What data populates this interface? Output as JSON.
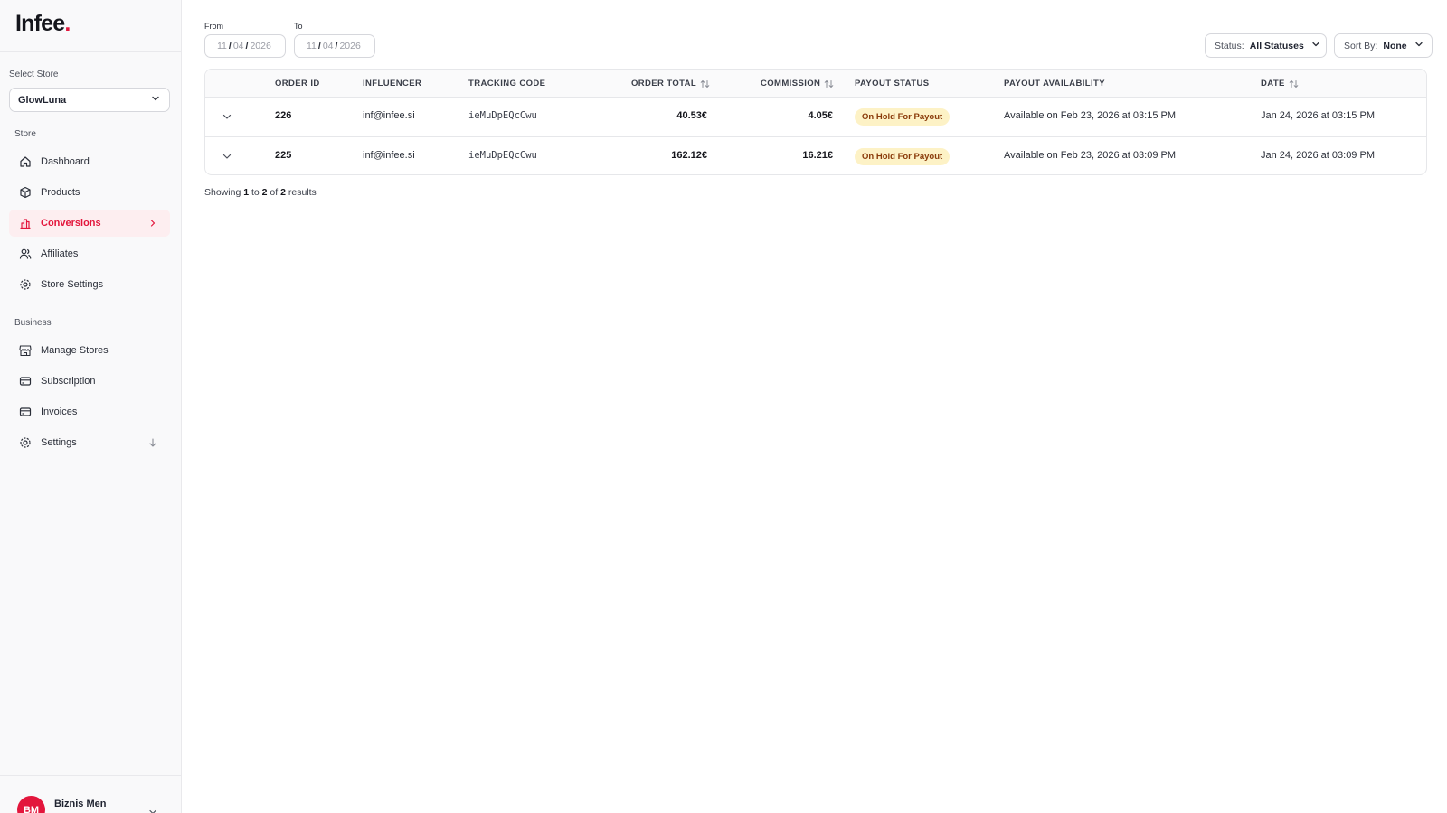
{
  "brand": {
    "name": "Infee",
    "dot": "."
  },
  "sidebar": {
    "select_store_label": "Select Store",
    "selected_store": "GlowLuna",
    "store_section": "Store",
    "store_items": [
      {
        "label": "Dashboard",
        "icon": "home-icon"
      },
      {
        "label": "Products",
        "icon": "box-icon"
      },
      {
        "label": "Conversions",
        "icon": "bar-chart-icon",
        "active": true
      },
      {
        "label": "Affiliates",
        "icon": "users-icon"
      },
      {
        "label": "Store Settings",
        "icon": "gear-icon"
      }
    ],
    "business_section": "Business",
    "business_items": [
      {
        "label": "Manage Stores",
        "icon": "storefront-icon"
      },
      {
        "label": "Subscription",
        "icon": "card-icon"
      },
      {
        "label": "Invoices",
        "icon": "card-icon"
      },
      {
        "label": "Settings",
        "icon": "gear-icon"
      }
    ],
    "user": {
      "initials": "BM",
      "name": "Biznis Men"
    }
  },
  "filters": {
    "from_label": "From",
    "to_label": "To",
    "from": {
      "day": "11",
      "month": "04",
      "year": "2026"
    },
    "to": {
      "day": "11",
      "month": "04",
      "year": "2026"
    },
    "status_label": "Status:",
    "status_value": "All Statuses",
    "sort_label": "Sort By:",
    "sort_value": "None"
  },
  "table": {
    "columns": {
      "order_id": "ORDER ID",
      "influencer": "INFLUENCER",
      "tracking_code": "TRACKING CODE",
      "order_total": "ORDER TOTAL",
      "commission": "COMMISSION",
      "payout_status": "PAYOUT STATUS",
      "payout_availability": "PAYOUT AVAILABILITY",
      "date": "DATE"
    },
    "rows": [
      {
        "order_id": "226",
        "influencer": "inf@infee.si",
        "tracking_code": "ieMuDpEQcCwu",
        "order_total": "40.53€",
        "commission": "4.05€",
        "payout_status": "On Hold For Payout",
        "payout_availability": "Available on Feb 23, 2026 at 03:15 PM",
        "date": "Jan 24, 2026 at 03:15 PM"
      },
      {
        "order_id": "225",
        "influencer": "inf@infee.si",
        "tracking_code": "ieMuDpEQcCwu",
        "order_total": "162.12€",
        "commission": "16.21€",
        "payout_status": "On Hold For Payout",
        "payout_availability": "Available on Feb 23, 2026 at 03:09 PM",
        "date": "Jan 24, 2026 at 03:09 PM"
      }
    ]
  },
  "pagination": {
    "prefix": "Showing",
    "from": "1",
    "to_word": "to",
    "to": "2",
    "of_word": "of",
    "total": "2",
    "suffix": "results"
  },
  "colors": {
    "accent": "#e3163c",
    "badge_bg": "#fdf2c6",
    "badge_text": "#8a3b0a"
  }
}
